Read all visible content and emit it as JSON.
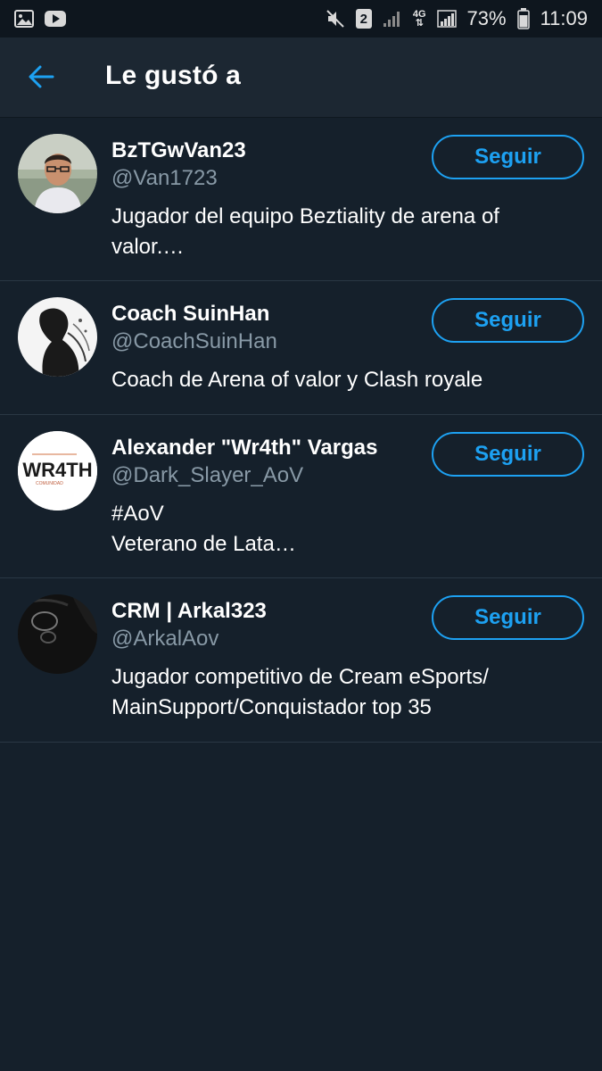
{
  "status_bar": {
    "signal_badge": "2",
    "network": "4G",
    "battery": "73%",
    "time": "11:09"
  },
  "header": {
    "title": "Le gustó a"
  },
  "users": [
    {
      "name": "BzTGwVan23",
      "handle": "@Van1723",
      "bio": "Jugador del equipo Beztiality de arena of\nvalor.…",
      "follow_label": "Seguir"
    },
    {
      "name": "Coach SuinHan",
      "handle": "@CoachSuinHan",
      "bio": "Coach de Arena of valor y Clash royale",
      "follow_label": "Seguir"
    },
    {
      "name": "Alexander \"Wr4th\" Vargas",
      "handle": "@Dark_Slayer_AoV",
      "bio": "#AoV\nVeterano de Lata…",
      "follow_label": "Seguir",
      "avatar_text": "WR4TH"
    },
    {
      "name": "CRM | Arkal323",
      "handle": "@ArkalAov",
      "bio": "Jugador competitivo de Cream eSports/\nMainSupport/Conquistador top 35",
      "follow_label": "Seguir"
    }
  ],
  "colors": {
    "background": "#15202b",
    "header": "#1c2732",
    "accent": "#1da1f2",
    "secondary_text": "#8899a6",
    "divider": "#2a3744"
  },
  "icons": {
    "back": "arrow-left-icon",
    "status_left": [
      "image-icon",
      "youtube-icon"
    ],
    "status_right": [
      "mute-icon",
      "sim-badge-icon",
      "signal-icon",
      "network-4g-icon",
      "signal-icon",
      "battery-icon"
    ]
  }
}
